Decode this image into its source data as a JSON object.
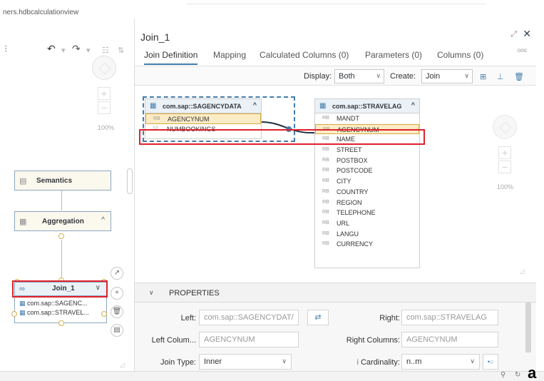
{
  "window": {
    "file_title": "ners.hdbcalculationview"
  },
  "left_pane": {
    "zoom_label": "100%",
    "nodes": {
      "semantics": {
        "label": "Semantics"
      },
      "aggregation": {
        "label": "Aggregation"
      },
      "join": {
        "label": "Join_1",
        "sources": [
          "com.sap::SAGENC...",
          "com.sap::STRAVEL..."
        ]
      }
    }
  },
  "panel": {
    "title": "Join_1",
    "tabs": [
      {
        "label": "Join Definition"
      },
      {
        "label": "Mapping"
      },
      {
        "label": "Calculated Columns (0)"
      },
      {
        "label": "Parameters (0)"
      },
      {
        "label": "Columns (0)"
      }
    ],
    "tab_more": "ooo",
    "display": {
      "display_label": "Display:",
      "display_value": "Both",
      "create_label": "Create:",
      "create_value": "Join"
    },
    "canvas": {
      "zoom_label": "100%",
      "left_table": {
        "name": "com.sap::SAGENCYDATA",
        "columns": [
          {
            "type": "RB",
            "name": "AGENCYNUM"
          },
          {
            "type": "12",
            "name": "NUMBOOKINGS"
          }
        ]
      },
      "right_table": {
        "name": "com.sap::STRAVELAG",
        "columns": [
          {
            "type": "RB",
            "name": "MANDT"
          },
          {
            "type": "RB",
            "name": "AGENCYNUM"
          },
          {
            "type": "RB",
            "name": "NAME"
          },
          {
            "type": "RB",
            "name": "STREET"
          },
          {
            "type": "RB",
            "name": "POSTBOX"
          },
          {
            "type": "RB",
            "name": "POSTCODE"
          },
          {
            "type": "RB",
            "name": "CITY"
          },
          {
            "type": "RB",
            "name": "COUNTRY"
          },
          {
            "type": "RB",
            "name": "REGION"
          },
          {
            "type": "RB",
            "name": "TELEPHONE"
          },
          {
            "type": "RB",
            "name": "URL"
          },
          {
            "type": "RB",
            "name": "LANGU"
          },
          {
            "type": "RB",
            "name": "CURRENCY"
          }
        ]
      }
    },
    "properties": {
      "title": "PROPERTIES",
      "left_label": "Left:",
      "left_value": "com.sap::SAGENCYDAT/",
      "right_label": "Right:",
      "right_value": "com.sap::STRAVELAG",
      "left_columns_label": "Left Colum...",
      "left_columns_value": "AGENCYNUM",
      "right_columns_label": "Right Columns:",
      "right_columns_value": "AGENCYNUM",
      "join_type_label": "Join Type:",
      "join_type_value": "Inner",
      "cardinality_label": "Cardinality:",
      "cardinality_value": "n..m"
    }
  },
  "corner_label": "a"
}
